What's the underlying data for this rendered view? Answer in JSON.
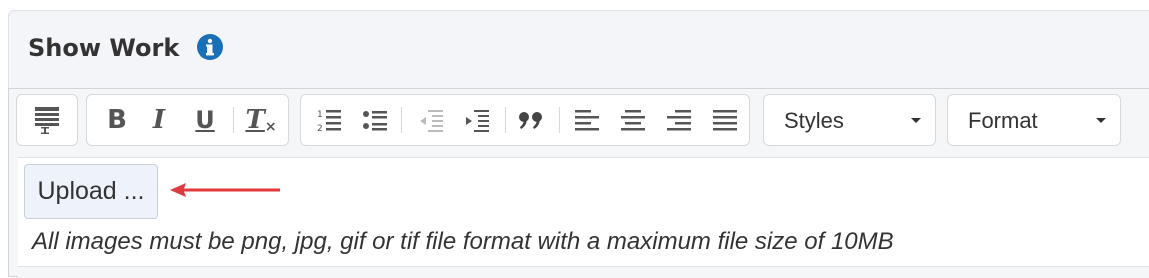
{
  "section": {
    "title": "Show Work",
    "info_icon": "info-circle-icon",
    "info_color": "#1a6fb9"
  },
  "toolbar": {
    "buttons": [
      {
        "name": "source-icon"
      },
      {
        "name": "bold-icon",
        "glyph": "B"
      },
      {
        "name": "italic-icon",
        "glyph": "I"
      },
      {
        "name": "underline-icon",
        "glyph": "U"
      },
      {
        "name": "remove-format-icon",
        "glyph": "T"
      },
      {
        "name": "numbered-list-icon"
      },
      {
        "name": "bulleted-list-icon"
      },
      {
        "name": "decrease-indent-icon"
      },
      {
        "name": "increase-indent-icon"
      },
      {
        "name": "blockquote-icon",
        "glyph": "99"
      },
      {
        "name": "align-left-icon"
      },
      {
        "name": "align-center-icon"
      },
      {
        "name": "align-right-icon"
      },
      {
        "name": "justify-icon"
      }
    ],
    "styles_label": "Styles",
    "format_label": "Format"
  },
  "editor": {
    "upload_label": "Upload ...",
    "arrow_color": "#e0393e",
    "note": "All images must be png, jpg, gif or tif file format with a maximum file size of 10MB"
  }
}
